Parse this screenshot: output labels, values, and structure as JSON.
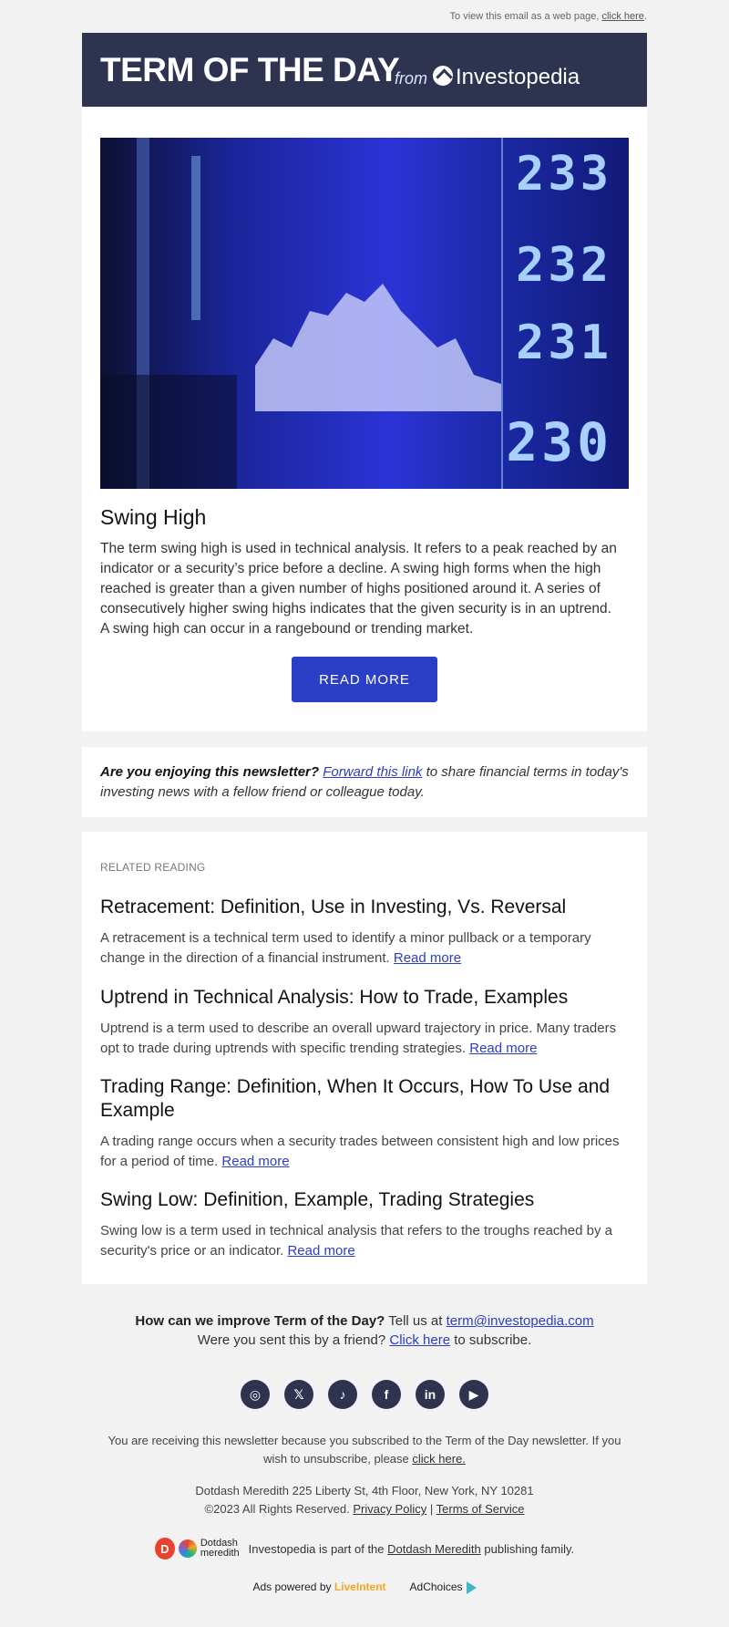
{
  "topline": {
    "text": "To view this email as a web page,",
    "link": "click here",
    "end": "."
  },
  "header": {
    "title": "TERM OF THE DAY",
    "from": "from",
    "brand": "Investopedia",
    "bg_color": "#2e3450"
  },
  "term": {
    "title": "Swing High",
    "body": "The term swing high is used in technical analysis. It refers to a peak reached by an indicator or a security’s price before a decline. A swing high forms when the high reached is greater than a given number of highs positioned around it. A series of consecutively higher swing highs indicates that the given security is in an uptrend. A swing high can occur in a rangebound or trending market.",
    "button": "READ MORE",
    "ticker_values": [
      "233",
      "232",
      "231",
      "230"
    ]
  },
  "share": {
    "question": "Are you enjoying this newsletter?",
    "link": "Forward this link",
    "rest": "to share financial terms in today's investing news with a fellow friend or colleague today."
  },
  "related": {
    "label": "RELATED READING",
    "items": [
      {
        "title": "Retracement: Definition, Use in Investing, Vs. Reversal",
        "text": "A retracement is a technical term used to identify a minor pullback or a temporary change in the direction of a financial instrument.",
        "link": "Read more"
      },
      {
        "title": "Uptrend in Technical Analysis: How to Trade, Examples",
        "text": "Uptrend is a term used to describe an overall upward trajectory in price. Many traders opt to trade during uptrends with specific trending strategies.",
        "link": "Read more"
      },
      {
        "title": "Trading Range: Definition, When It Occurs, How To Use and Example",
        "text": "A trading range occurs when a security trades between consistent high and low prices for a period of time.",
        "link": "Read more"
      },
      {
        "title": "Swing Low: Definition, Example, Trading Strategies",
        "text": "Swing low is a term used in technical analysis that refers to the troughs reached by a security's price or an indicator.",
        "link": "Read more"
      }
    ]
  },
  "footer": {
    "improve_q": "How can we improve Term of the Day?",
    "improve_rest": "Tell us at",
    "email": "term@investopedia.com",
    "friend": "Were you sent this by a friend?",
    "friend_link": "Click here",
    "friend_rest": "to subscribe.",
    "socials": [
      "instagram-icon",
      "x-icon",
      "tiktok-icon",
      "facebook-icon",
      "linkedin-icon",
      "youtube-icon"
    ],
    "social_glyphs": [
      "◎",
      "𝕏",
      "♪",
      "f",
      "in",
      "▶"
    ],
    "note": "You are receiving this newsletter because you subscribed to the Term of the Day newsletter. If you wish to unsubscribe, please",
    "note_link": "click here.",
    "address": "Dotdash Meredith 225 Liberty St, 4th Floor, New York, NY 10281",
    "copyright": "©2023 All Rights Reserved.",
    "privacy": "Privacy Policy",
    "sep": "|",
    "terms": "Terms of Service",
    "dd_logo_top": "Dotdash",
    "dd_logo_bottom": "meredith",
    "family_pre": "Investopedia is part of the",
    "family_link": "Dotdash Meredith",
    "family_post": "publishing family.",
    "ads_powered": "Ads powered by",
    "liveintent": "LiveIntent",
    "adchoices": "AdChoices"
  }
}
